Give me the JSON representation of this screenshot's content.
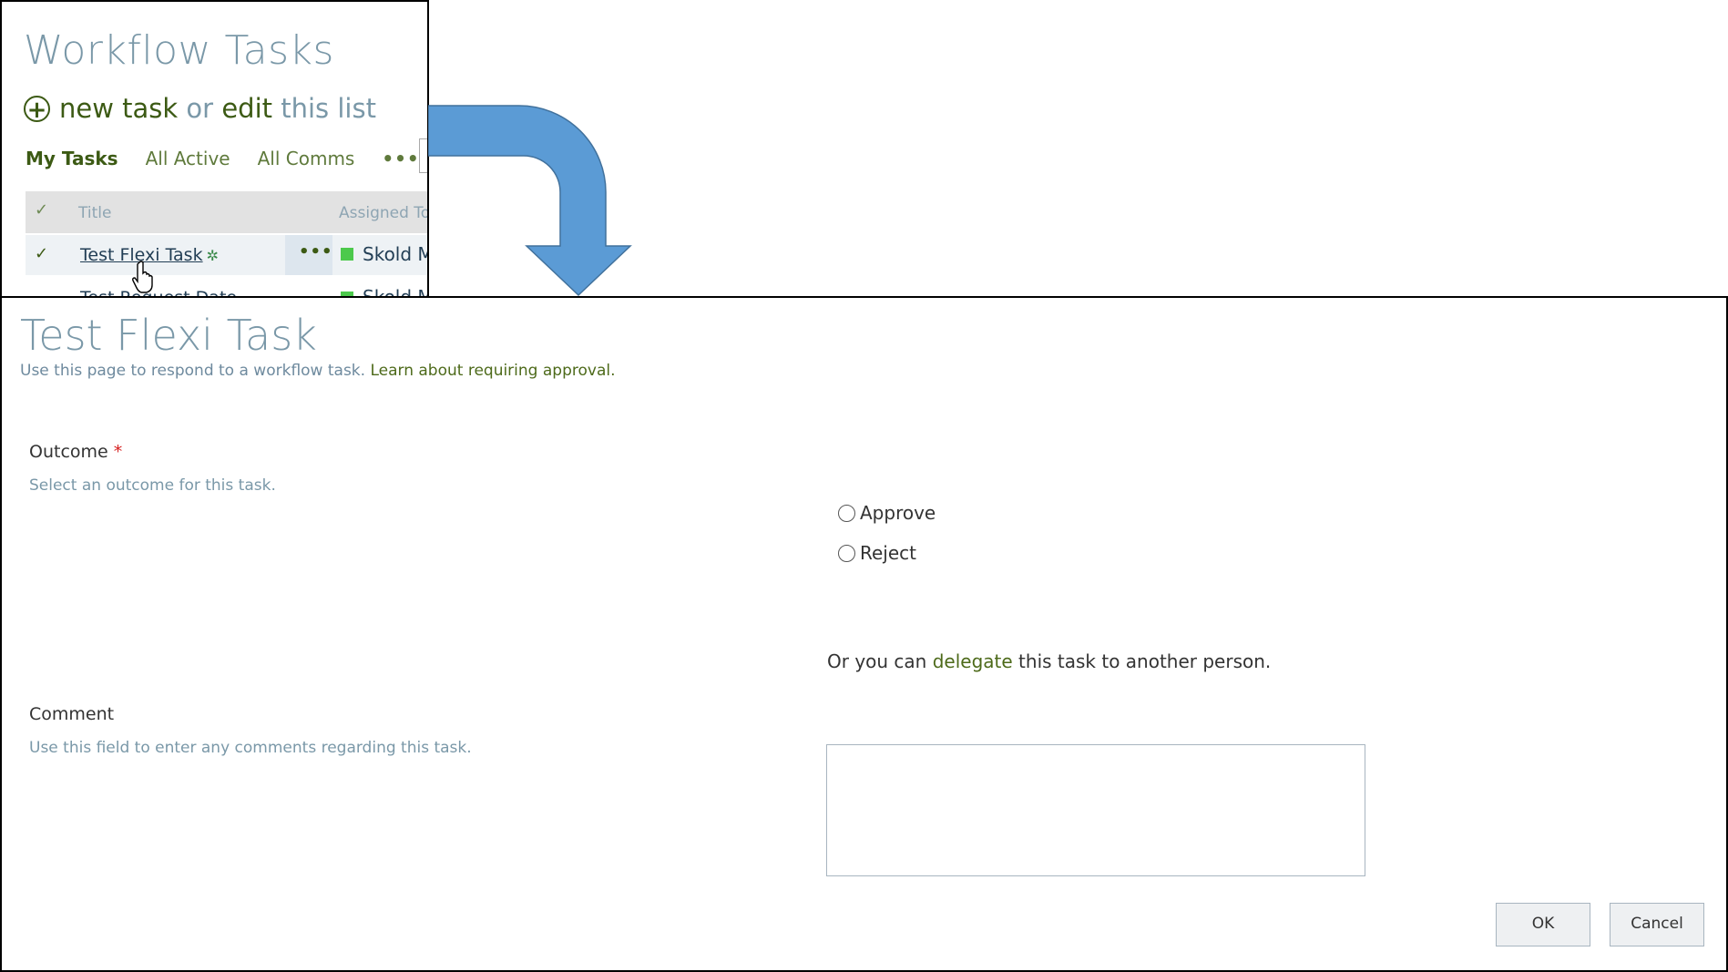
{
  "list_panel": {
    "title": "Workflow Tasks",
    "new_task": {
      "new_task_label": "new task",
      "or_label": "or",
      "edit_label": "edit",
      "this_list_label": "this list"
    },
    "views": {
      "active": "My Tasks",
      "items": [
        "All Active",
        "All Comms"
      ],
      "more": "•••"
    },
    "columns": {
      "title": "Title",
      "assigned_to": "Assigned To"
    },
    "rows": [
      {
        "title": "Test Flexi Task",
        "new_marker": "✲",
        "menu": "•••",
        "assigned_to": "Skold M"
      },
      {
        "title": "Test Request Date",
        "assigned_to": "Skold M"
      }
    ]
  },
  "form": {
    "title": "Test Flexi Task",
    "description": "Use this page to respond to a workflow task.",
    "description_link": "Learn about requiring approval.",
    "outcome": {
      "label": "Outcome",
      "required_mark": "*",
      "description": "Select an outcome for this task.",
      "options": [
        "Approve",
        "Reject"
      ]
    },
    "delegate": {
      "prefix": "Or you can",
      "link": "delegate",
      "suffix": "this task to another person."
    },
    "comment": {
      "label": "Comment",
      "description": "Use this field to enter any comments regarding this task.",
      "value": ""
    },
    "buttons": {
      "ok": "OK",
      "cancel": "Cancel"
    }
  },
  "colors": {
    "arrow": "#5b9bd5",
    "title_gray": "#7a98a8",
    "link_green": "#4d6a1a",
    "presence_green": "#4cc94c"
  }
}
